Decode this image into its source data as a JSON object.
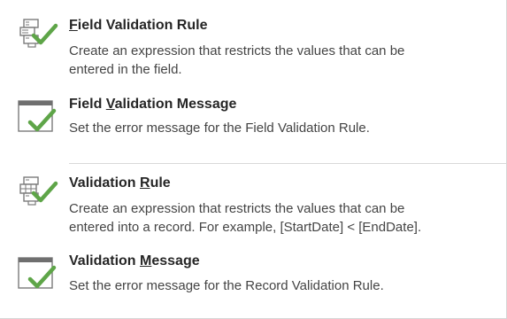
{
  "menu": {
    "items": [
      {
        "key": "field_validation_rule",
        "title_pre": "",
        "title_u": "F",
        "title_post": "ield Validation Rule",
        "desc1": "Create an expression that restricts the values that can be",
        "desc2": "entered in the field.",
        "icon": "validation-rule-icon"
      },
      {
        "key": "field_validation_message",
        "title_pre": "Field ",
        "title_u": "V",
        "title_post": "alidation Message",
        "desc1": "Set the error message for the Field Validation Rule.",
        "desc2": "",
        "icon": "validation-message-icon"
      },
      {
        "key": "validation_rule",
        "title_pre": "Validation ",
        "title_u": "R",
        "title_post": "ule",
        "desc1": "Create an expression that restricts the values that can be",
        "desc2": "entered into a record.  For example, [StartDate] < [EndDate].",
        "icon": "record-validation-rule-icon"
      },
      {
        "key": "validation_message",
        "title_pre": "Validation ",
        "title_u": "M",
        "title_post": "essage",
        "desc1": "Set the error message for the Record Validation Rule.",
        "desc2": "",
        "icon": "validation-message-icon"
      }
    ]
  },
  "colors": {
    "check_green": "#5ea548",
    "icon_gray": "#7a7a7a",
    "divider": "#d9d9d9"
  }
}
